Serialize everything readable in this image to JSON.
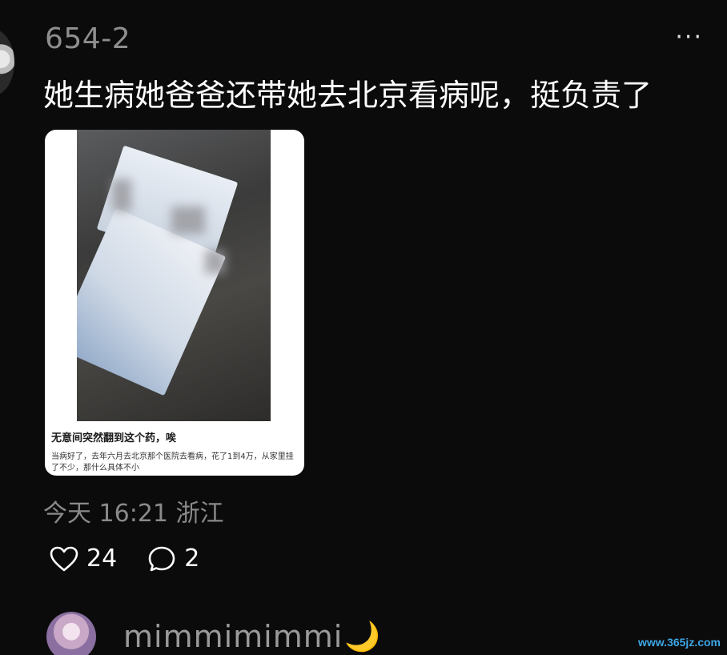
{
  "post": {
    "username": "654-2",
    "more_icon": "more-icon",
    "text": "她生病她爸爸还带她去北京看病呢，挺负责了",
    "photo": {
      "caption_title": "无意间突然翻到这个药，唉",
      "caption_body": "当病好了，去年六月去北京那个医院去看病，花了1到4万，从家里挂了不少，那什么具体不小"
    },
    "meta": "今天 16:21 浙江",
    "likes": "24",
    "comments": "2"
  },
  "reply": {
    "username": "mimmimimmi",
    "emoji": "🌙"
  },
  "watermark": "www.365jz.com",
  "colors": {
    "background": "#0b0b0c",
    "username": "#8e8e8e",
    "meta": "#8a8a8a",
    "watermark": "#3da7e6"
  }
}
